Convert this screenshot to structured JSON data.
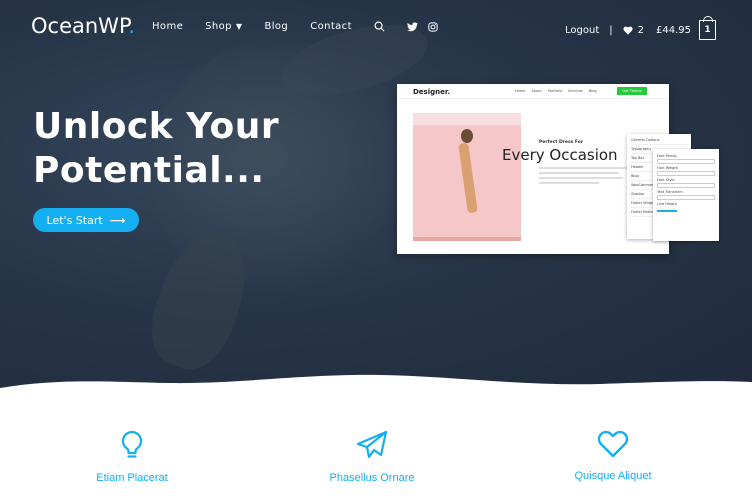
{
  "header": {
    "logo_text": "OceanWP",
    "logo_dot": ".",
    "nav": [
      {
        "label": "Home"
      },
      {
        "label": "Shop",
        "has_dropdown": true
      },
      {
        "label": "Blog"
      },
      {
        "label": "Contact"
      }
    ],
    "icons": [
      "search-icon",
      "twitter-icon",
      "instagram-icon"
    ],
    "logout_label": "Logout",
    "separator": "|",
    "wishlist_count": "2",
    "cart_total": "£44.95",
    "cart_count": "1"
  },
  "hero": {
    "headline_line1": "Unlock Your",
    "headline_line2": "Potential...",
    "cta_label": "Let's Start",
    "cta_arrow": "⟶"
  },
  "mockup": {
    "brand": "Designer.",
    "nav": [
      "Home",
      "About",
      "Portfolio",
      "Services",
      "Blog"
    ],
    "buy_label": "Get Theme",
    "subtitle": "Perfect Dress For",
    "title": "Every Occasion",
    "customizer_items": [
      "General Options",
      "Typography",
      "Top Bar",
      "Header",
      "Blog",
      "WooCommerce",
      "Sidebar",
      "Footer Widgets",
      "Footer Bottom"
    ],
    "typography_fields": [
      "Font Family",
      "Font Weight",
      "Font Style",
      "Text Transform",
      "Line Height"
    ]
  },
  "features": [
    {
      "icon": "lightbulb-icon",
      "title": "Etiam Placerat"
    },
    {
      "icon": "paper-plane-icon",
      "title": "Phasellus Ornare"
    },
    {
      "icon": "heart-icon",
      "title": "Quisque Aliquet"
    }
  ],
  "colors": {
    "accent": "#13aff0",
    "hero_bg": "#273548"
  }
}
